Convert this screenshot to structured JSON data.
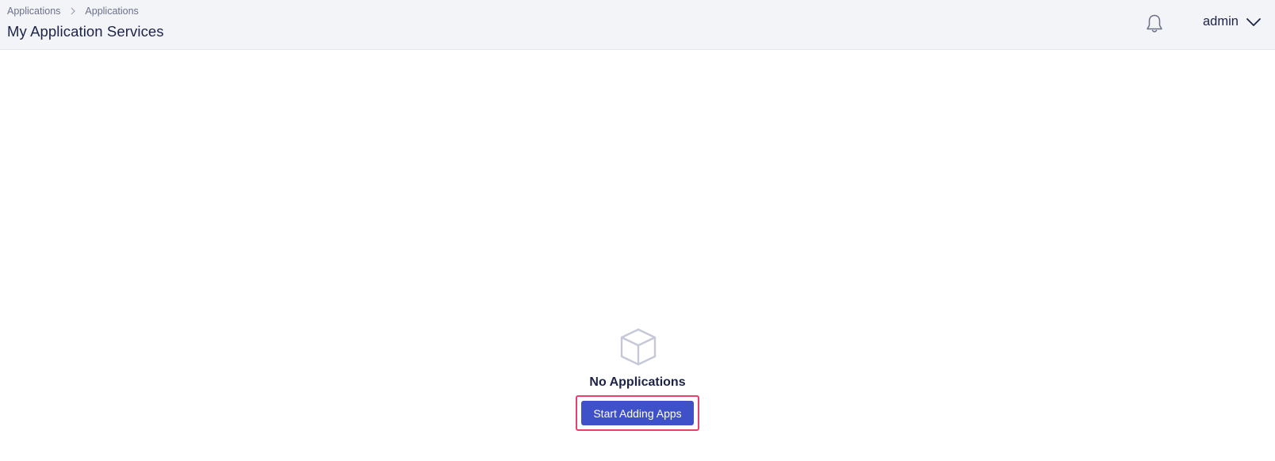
{
  "header": {
    "breadcrumb": [
      "Applications",
      "Applications"
    ],
    "title": "My Application Services",
    "user": "admin"
  },
  "icons": {
    "breadcrumb_separator": "chevron-right-icon",
    "notifications": "bell-icon",
    "user_menu": "chevron-down-icon",
    "empty_state": "cube-icon"
  },
  "empty_state": {
    "title": "No Applications",
    "button_label": "Start Adding Apps"
  },
  "colors": {
    "header_bg": "#f3f4f8",
    "primary": "#3f51c8",
    "text_dark": "#1d2347",
    "highlight_border": "#e8406b",
    "muted_icon": "#c5c8d6"
  }
}
